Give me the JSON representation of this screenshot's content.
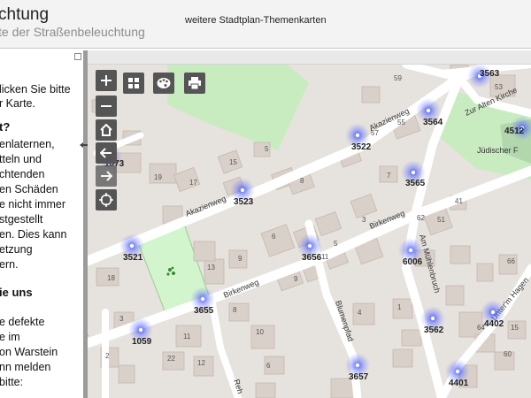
{
  "header": {
    "title": "chtung",
    "subtitle": "te der Straßenbeleuchtung",
    "themen_link": "weitere Stadtplan-Themenkarten"
  },
  "sidebar": {
    "lines": [
      {
        "text": "licken Sie bitte",
        "bold": false
      },
      {
        "text": "r Karte.",
        "bold": false
      },
      {
        "text": "t?",
        "bold": true
      },
      {
        "text": "enlaternen,",
        "bold": false
      },
      {
        "text": "tteln und",
        "bold": false
      },
      {
        "text": "chtenden",
        "bold": false
      },
      {
        "text": "en Schäden",
        "bold": false
      },
      {
        "text": "e nicht immer",
        "bold": false
      },
      {
        "text": "stgestellt",
        "bold": false
      },
      {
        "text": "en. Dies kann",
        "bold": false
      },
      {
        "text": "etzung",
        "bold": false
      },
      {
        "text": "ern.",
        "bold": false
      },
      {
        "text": "ie uns",
        "bold": true
      },
      {
        "text": "e defekte",
        "bold": false
      },
      {
        "text": "e im",
        "bold": false
      },
      {
        "text": "on Warstein",
        "bold": false
      },
      {
        "text": "nn melden",
        "bold": false
      },
      {
        "text": "bitte:",
        "bold": false
      }
    ]
  },
  "map": {
    "streets": [
      "Akazienweg",
      "Akazienweg",
      "Birkenweg",
      "Birkenweg",
      "Am Mühlenbruch",
      "Blumenpfad",
      "Zur Alten Kirche",
      "Unter'm Hagen",
      "Reh",
      "weg"
    ],
    "poi": "Jüdischer F",
    "lamps": [
      "3563",
      "3564",
      "4512",
      "3522",
      "1073",
      "3565",
      "3523",
      "3521",
      "3656",
      "6006",
      "3655",
      "1059",
      "3562",
      "4402",
      "3657",
      "4401"
    ],
    "buildings": [
      "15",
      "5",
      "19",
      "17",
      "8",
      "6",
      "9",
      "13",
      "11",
      "9",
      "5",
      "3",
      "7",
      "62",
      "57",
      "55",
      "59",
      "53",
      "51",
      "41",
      "66",
      "64",
      "60",
      "15",
      "11",
      "22",
      "12",
      "10",
      "8",
      "6",
      "18",
      "3",
      "2",
      "4",
      "1"
    ]
  },
  "controls": {
    "zoom_in": "+",
    "zoom_out": "−",
    "home": "home-icon",
    "back": "arrow-left-icon",
    "locate": "crosshair-icon",
    "layers": "grid-icon",
    "palette": "palette-icon",
    "print": "print-icon"
  },
  "colors": {
    "map_bg": "#e6e2dd",
    "road": "#ffffff",
    "green": "#c8ecc0",
    "building": "#d9d0c9",
    "lamp_glow": "#3c4cff",
    "control_bg": "#555555"
  }
}
